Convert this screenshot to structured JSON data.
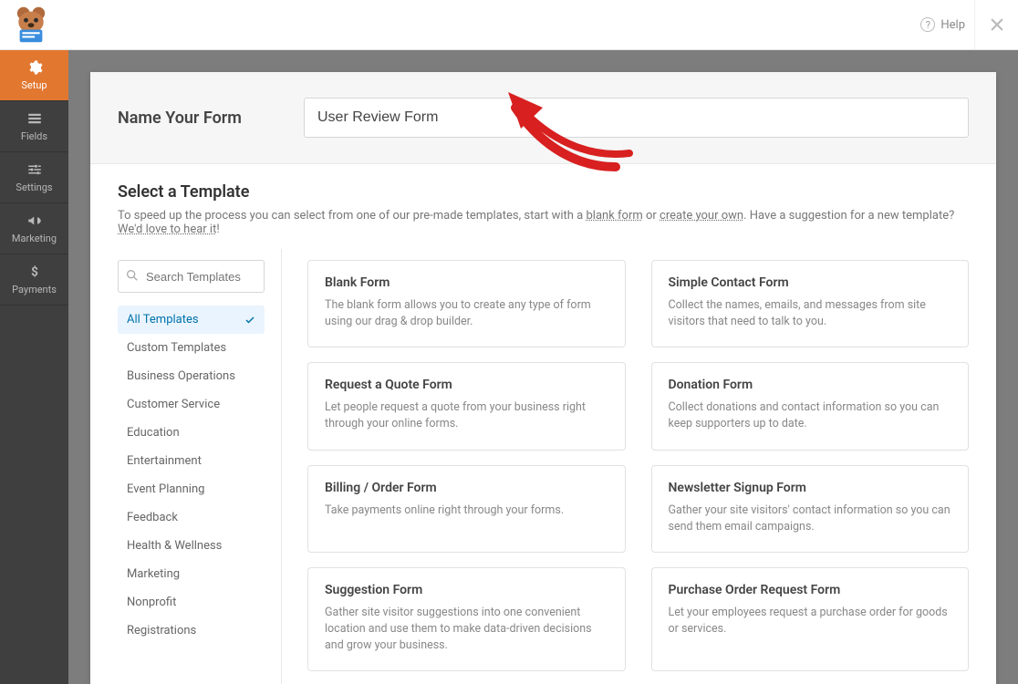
{
  "topbar": {
    "help_label": "Help"
  },
  "sidebar": {
    "items": [
      {
        "label": "Setup"
      },
      {
        "label": "Fields"
      },
      {
        "label": "Settings"
      },
      {
        "label": "Marketing"
      },
      {
        "label": "Payments"
      }
    ]
  },
  "name_section": {
    "heading": "Name Your Form",
    "value": "User Review Form"
  },
  "template_header": {
    "heading": "Select a Template",
    "intro_pre": "To speed up the process you can select from one of our pre-made templates, start with a ",
    "blank_link": "blank form",
    "intro_mid": " or ",
    "create_link": "create your own",
    "intro_post": ". Have a suggestion for a new template? ",
    "suggest_link": "We'd love to hear it",
    "intro_end": "!"
  },
  "search": {
    "placeholder": "Search Templates"
  },
  "categories": [
    {
      "label": "All Templates"
    },
    {
      "label": "Custom Templates"
    },
    {
      "label": "Business Operations"
    },
    {
      "label": "Customer Service"
    },
    {
      "label": "Education"
    },
    {
      "label": "Entertainment"
    },
    {
      "label": "Event Planning"
    },
    {
      "label": "Feedback"
    },
    {
      "label": "Health & Wellness"
    },
    {
      "label": "Marketing"
    },
    {
      "label": "Nonprofit"
    },
    {
      "label": "Registrations"
    }
  ],
  "templates": [
    {
      "title": "Blank Form",
      "desc": "The blank form allows you to create any type of form using our drag & drop builder."
    },
    {
      "title": "Simple Contact Form",
      "desc": "Collect the names, emails, and messages from site visitors that need to talk to you."
    },
    {
      "title": "Request a Quote Form",
      "desc": "Let people request a quote from your business right through your online forms."
    },
    {
      "title": "Donation Form",
      "desc": "Collect donations and contact information so you can keep supporters up to date."
    },
    {
      "title": "Billing / Order Form",
      "desc": "Take payments online right through your forms."
    },
    {
      "title": "Newsletter Signup Form",
      "desc": "Gather your site visitors' contact information so you can send them email campaigns."
    },
    {
      "title": "Suggestion Form",
      "desc": "Gather site visitor suggestions into one convenient location and use them to make data-driven decisions and grow your business."
    },
    {
      "title": "Purchase Order Request Form",
      "desc": "Let your employees request a purchase order for goods or services."
    }
  ]
}
